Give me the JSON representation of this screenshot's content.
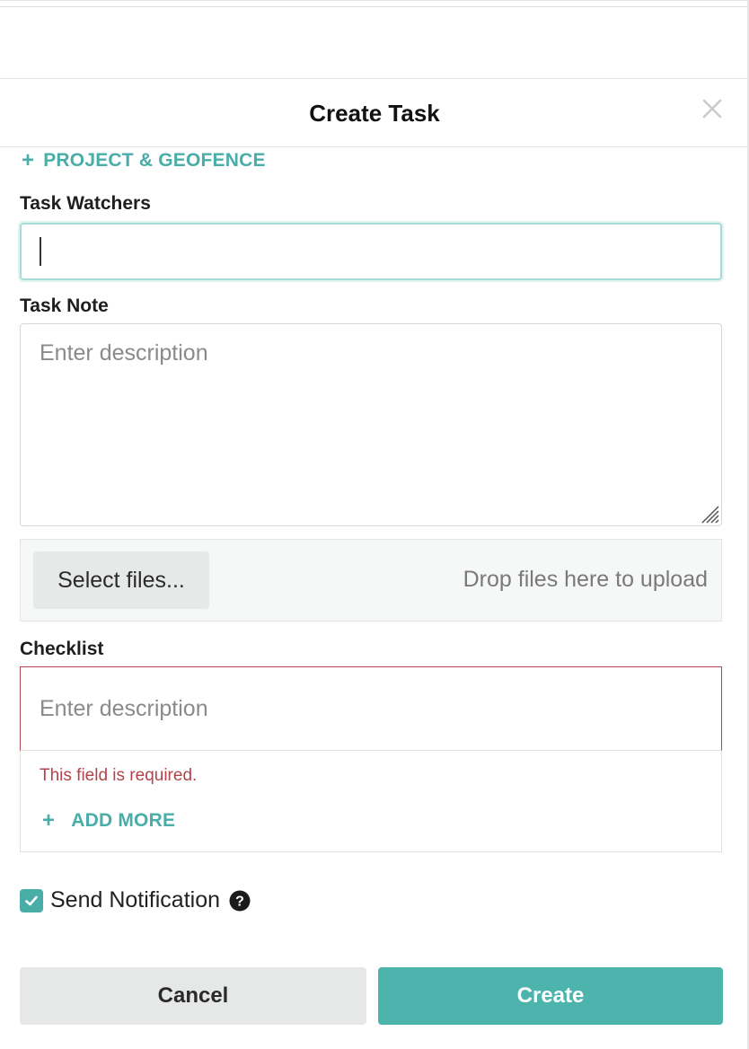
{
  "dialog": {
    "title": "Create Task",
    "close_icon": "close-icon"
  },
  "project_geofence": {
    "plus": "+",
    "label": "PROJECT & GEOFENCE"
  },
  "task_watchers": {
    "label": "Task Watchers",
    "value": ""
  },
  "task_note": {
    "label": "Task Note",
    "placeholder": "Enter description",
    "value": ""
  },
  "upload": {
    "select_label": "Select files...",
    "drop_hint": "Drop files here to upload"
  },
  "checklist": {
    "label": "Checklist",
    "placeholder": "Enter description",
    "value": "",
    "error": "This field is required.",
    "add_more_plus": "+",
    "add_more_label": "ADD MORE"
  },
  "send_notification": {
    "checked": true,
    "label": "Send Notification",
    "help_icon": "question-circle-icon"
  },
  "actions": {
    "cancel_label": "Cancel",
    "create_label": "Create"
  },
  "colors": {
    "accent": "#4db3ad",
    "error": "#b3434c"
  }
}
